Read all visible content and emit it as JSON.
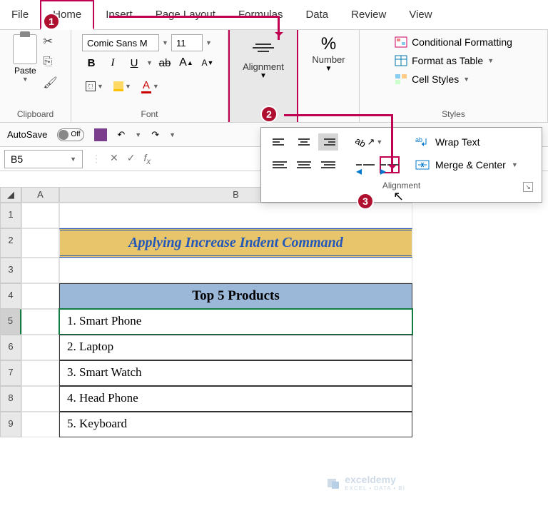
{
  "tabs": {
    "file": "File",
    "home": "Home",
    "insert": "Insert",
    "page_layout": "Page Layout",
    "formulas": "Formulas",
    "data": "Data",
    "review": "Review",
    "view": "View"
  },
  "clipboard": {
    "paste": "Paste",
    "label": "Clipboard"
  },
  "font": {
    "name": "Comic Sans M",
    "size": "11",
    "bold": "B",
    "italic": "I",
    "underline": "U",
    "strike": "ab",
    "grow": "A",
    "shrink": "A",
    "label": "Font"
  },
  "alignment": {
    "label": "Alignment"
  },
  "number": {
    "pct": "%",
    "label": "Number"
  },
  "styles": {
    "cond": "Conditional Formatting",
    "table": "Format as Table",
    "cell": "Cell Styles",
    "label": "Styles"
  },
  "qat": {
    "autosave": "AutoSave",
    "off": "Off"
  },
  "namebox": "B5",
  "panel": {
    "wrap": "Wrap Text",
    "merge": "Merge & Center",
    "label": "Alignment"
  },
  "sheet": {
    "colA": "A",
    "colB": "B",
    "rows": [
      "1",
      "2",
      "3",
      "4",
      "5",
      "6",
      "7",
      "8",
      "9"
    ],
    "title": "Applying Increase Indent Command",
    "header": "Top 5 Products",
    "items": [
      "1. Smart Phone",
      "2. Laptop",
      "3. Smart Watch",
      "4. Head Phone",
      "5. Keyboard"
    ]
  },
  "badges": {
    "b1": "1",
    "b2": "2",
    "b3": "3"
  },
  "watermark": {
    "brand": "exceldemy",
    "tag": "EXCEL • DATA • BI"
  }
}
